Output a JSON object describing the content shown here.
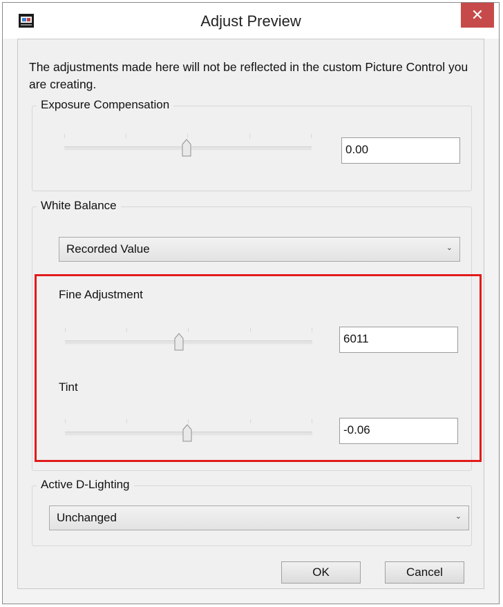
{
  "window": {
    "title": "Adjust Preview",
    "close_glyph": "✕"
  },
  "description": "The adjustments made here will not be reflected in the custom Picture Control you are creating.",
  "exposure": {
    "group_label": "Exposure Compensation",
    "value": "0.00",
    "slider_level": 0.5
  },
  "white_balance": {
    "group_label": "White Balance",
    "selected": "Recorded Value",
    "fine_adjustment_label": "Fine Adjustment",
    "fine_value": "6011",
    "fine_slider_level": 0.47,
    "tint_label": "Tint",
    "tint_value": "-0.06",
    "tint_slider_level": 0.5
  },
  "active_d_lighting": {
    "group_label": "Active D-Lighting",
    "selected": "Unchanged"
  },
  "buttons": {
    "ok_label": "OK",
    "cancel_label": "Cancel"
  },
  "colors": {
    "highlight": "#e21b1b",
    "close_button": "#c74a4a"
  }
}
